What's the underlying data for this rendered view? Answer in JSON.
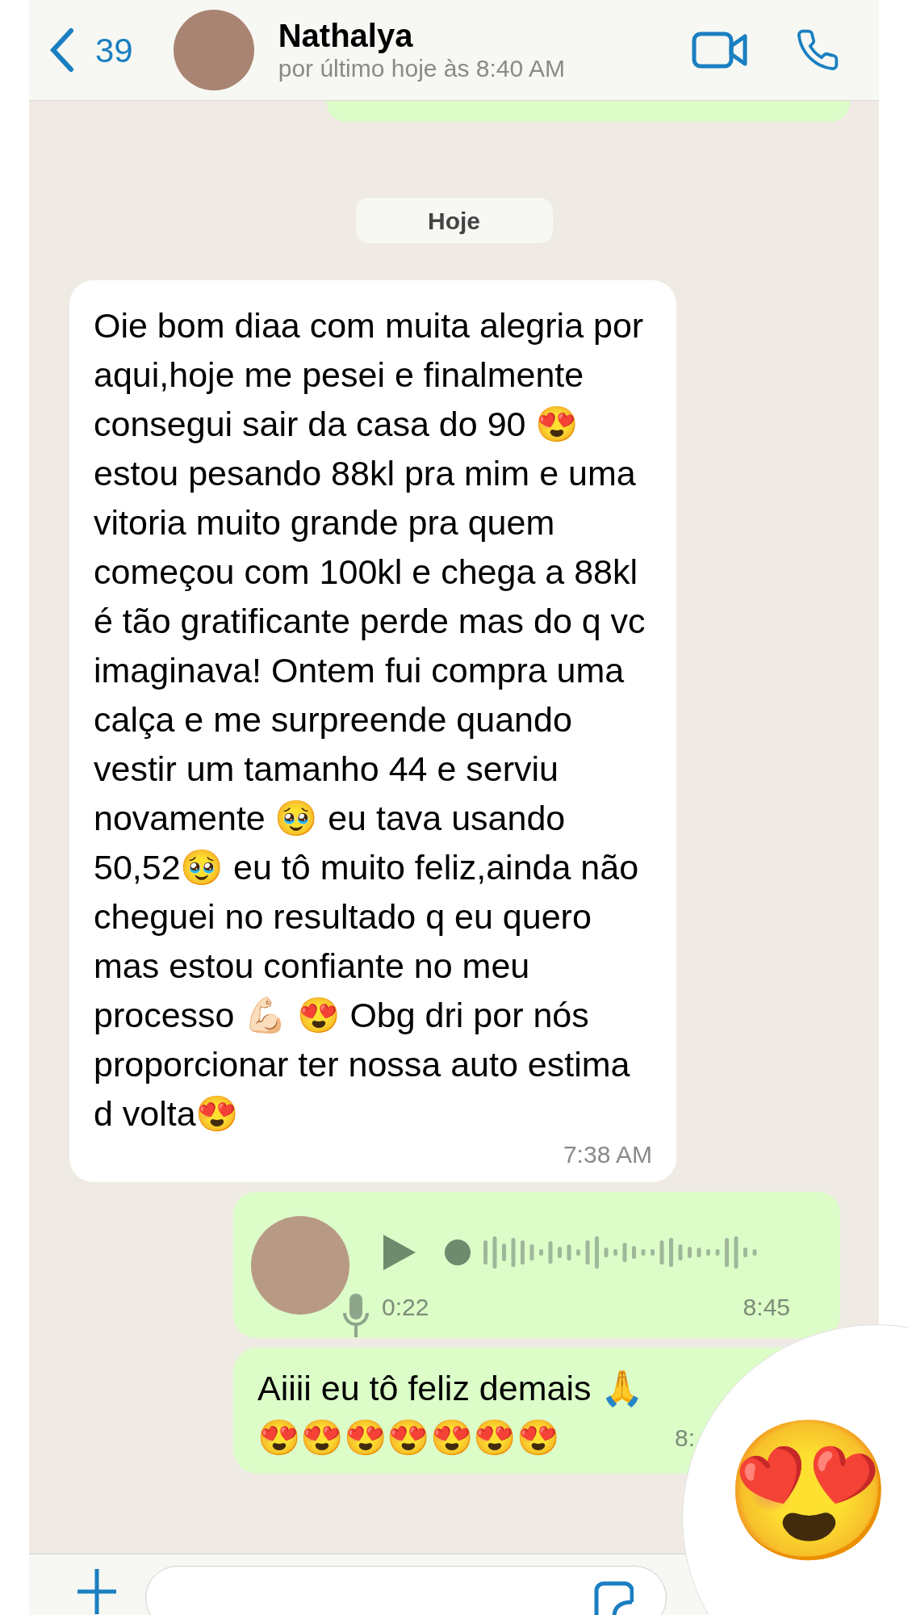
{
  "header": {
    "back_count": "39",
    "contact_name": "Nathalya",
    "status": "por último hoje às 8:40 AM"
  },
  "date_pill": "Hoje",
  "messages": [
    {
      "kind": "received",
      "text": "Oie bom diaa com muita alegria por aqui,hoje me pesei e finalmente consegui sair da casa do 90 😍 estou pesando 88kl pra mim e uma vitoria muito grande pra quem começou com 100kl e chega a 88kl é tão gratificante perde mas do q vc imaginava! Ontem fui compra uma calça e me surpreende quando vestir um tamanho 44 e serviu novamente 🥹 eu tava usando 50,52🥹 eu tô muito feliz,ainda não cheguei no resultado q eu quero mas estou confiante no meu processo 💪🏻 😍 Obg dri por nós proporcionar ter nossa auto estima d volta😍",
      "time": "7:38 AM"
    },
    {
      "kind": "voice",
      "duration": "0:22",
      "time": "8:45"
    },
    {
      "kind": "sent",
      "text": "Aiiii eu tô feliz demais 🙏",
      "text2": "😍😍😍😍😍😍😍",
      "time": "8:"
    }
  ],
  "emoji_preview": "😍"
}
